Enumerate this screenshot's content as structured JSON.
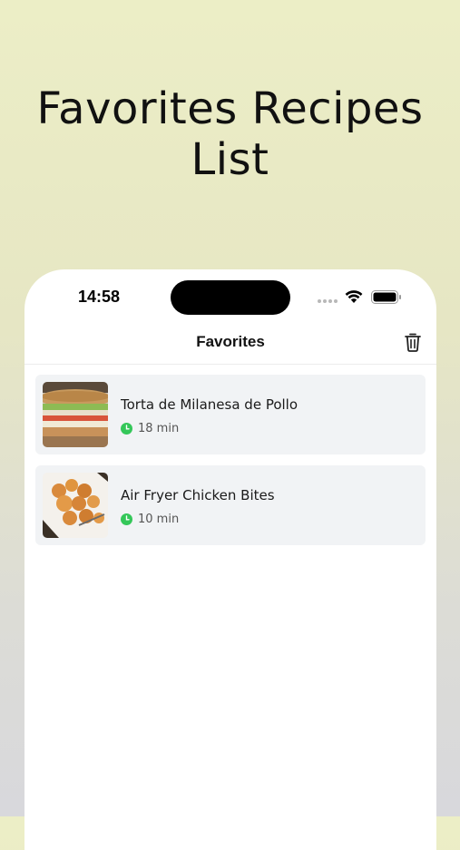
{
  "headline": {
    "line1": "Favorites Recipes",
    "line2": "List"
  },
  "status_bar": {
    "time": "14:58"
  },
  "nav": {
    "title": "Favorites",
    "delete_icon": "trash-icon"
  },
  "recipes": [
    {
      "title": "Torta de Milanesa de Pollo",
      "time": "18 min",
      "thumbnail": "sandwich-photo"
    },
    {
      "title": "Air Fryer Chicken Bites",
      "time": "10 min",
      "thumbnail": "chicken-bites-photo"
    }
  ],
  "colors": {
    "clock_icon": "#34c759",
    "card_background": "#f1f3f5",
    "background_top": "#eceec6",
    "background_bottom": "#d8d8dc"
  }
}
